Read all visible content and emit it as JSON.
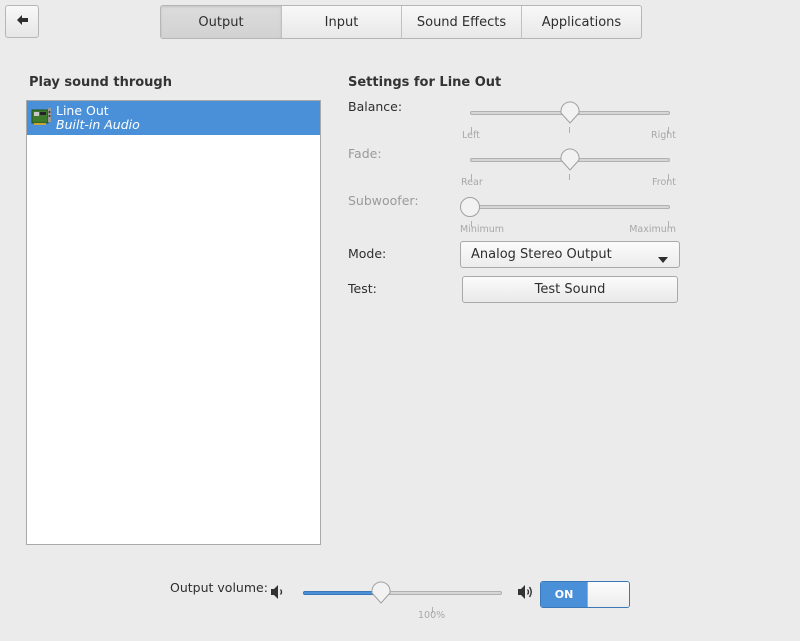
{
  "header": {
    "back_icon": "back-arrow-icon",
    "tabs": [
      {
        "label": "Output",
        "active": true
      },
      {
        "label": "Input",
        "active": false
      },
      {
        "label": "Sound Effects",
        "active": false
      },
      {
        "label": "Applications",
        "active": false
      }
    ]
  },
  "left": {
    "title": "Play sound through",
    "devices": [
      {
        "name": "Line Out",
        "description": "Built-in Audio",
        "icon": "sound-card-icon",
        "selected": true
      }
    ]
  },
  "right": {
    "title": "Settings for Line Out",
    "balance": {
      "label": "Balance:",
      "min_label": "Left",
      "max_label": "Right",
      "value": 0.5,
      "enabled": true
    },
    "fade": {
      "label": "Fade:",
      "min_label": "Rear",
      "max_label": "Front",
      "value": 0.5,
      "enabled": false
    },
    "subwoofer": {
      "label": "Subwoofer:",
      "min_label": "Minimum",
      "max_label": "Maximum",
      "value": 0.0,
      "enabled": false
    },
    "mode": {
      "label": "Mode:",
      "value": "Analog Stereo Output"
    },
    "test": {
      "label": "Test:",
      "button_label": "Test Sound"
    }
  },
  "footer": {
    "volume_label": "Output volume:",
    "volume_value": 0.39,
    "tick_label": "100%",
    "switch_label": "ON",
    "switch_on": true
  },
  "colors": {
    "accent": "#4a90d9",
    "background": "#ebebeb"
  }
}
